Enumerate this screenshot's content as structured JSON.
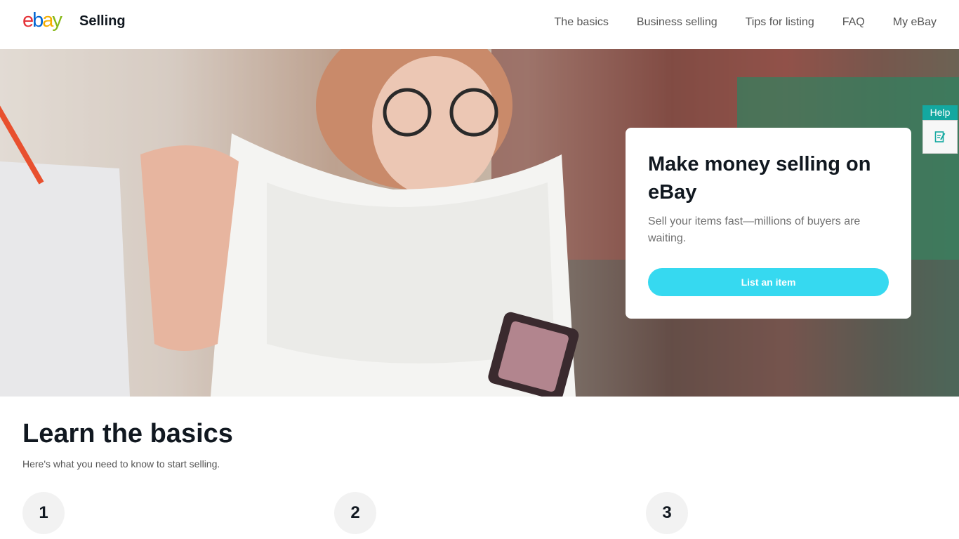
{
  "header": {
    "logo": {
      "e": "e",
      "b": "b",
      "a": "a",
      "y": "y"
    },
    "title": "Selling",
    "nav": [
      "The basics",
      "Business selling",
      "Tips for listing",
      "FAQ",
      "My eBay"
    ]
  },
  "hero": {
    "heading": "Make money selling on eBay",
    "subtext": "Sell your items fast—millions of buyers are waiting.",
    "cta_label": "List an item"
  },
  "help": {
    "label": "Help",
    "icon": "feedback-icon"
  },
  "basics": {
    "title": "Learn the basics",
    "subtitle": "Here's what you need to know to start selling.",
    "steps": [
      "1",
      "2",
      "3"
    ]
  },
  "colors": {
    "cta": "#36d9f0",
    "help": "#13a8a0"
  }
}
